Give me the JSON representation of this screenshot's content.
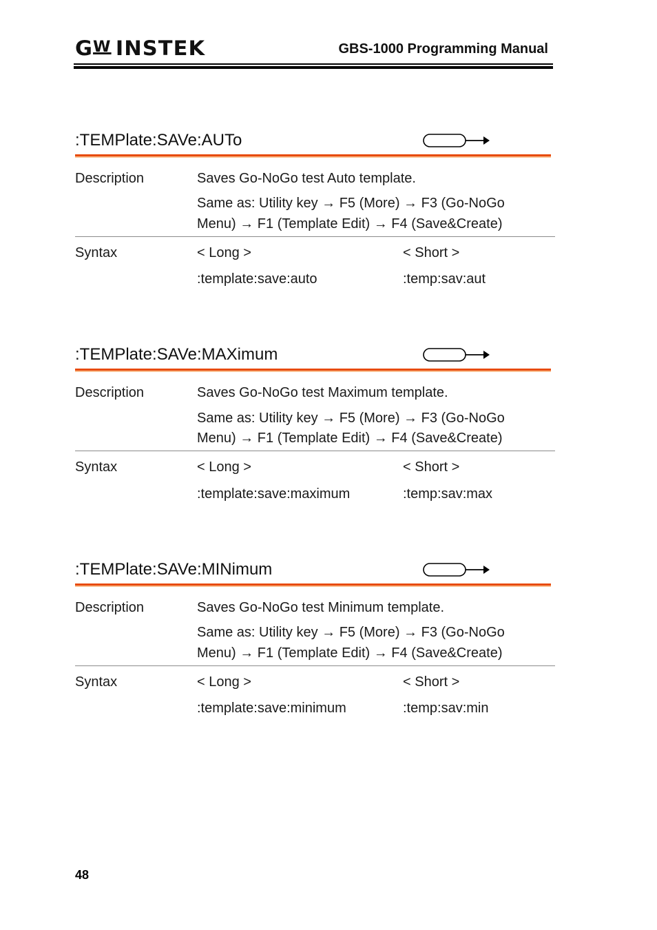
{
  "header": {
    "logo_text": "GW INSTEK",
    "manual_title": "GBS-1000 Programming Manual"
  },
  "labels": {
    "description": "Description",
    "syntax": "Syntax",
    "long_heading": "< Long >",
    "short_heading": "< Short >"
  },
  "accent_color": "#e84b0c",
  "sections": [
    {
      "command": ":TEMPlate:SAVe:AUTo",
      "icon": "set-command-icon",
      "description": "Saves Go-NoGo test Auto template.",
      "same_as_line1": "Same as: Utility key → F5 (More) → F3 (Go-NoGo",
      "same_as_line2": "Menu) → F1 (Template Edit) → F4 (Save&Create)",
      "long": ":template:save:auto",
      "short": ":temp:sav:aut"
    },
    {
      "command": ":TEMPlate:SAVe:MAXimum",
      "icon": "set-command-icon",
      "description": "Saves Go-NoGo test Maximum template.",
      "same_as_line1": "Same as: Utility key → F5 (More) → F3 (Go-NoGo",
      "same_as_line2": "Menu) → F1 (Template Edit) → F4 (Save&Create)",
      "long": ":template:save:maximum",
      "short": ":temp:sav:max"
    },
    {
      "command": ":TEMPlate:SAVe:MINimum",
      "icon": "set-command-icon",
      "description": "Saves Go-NoGo test Minimum template.",
      "same_as_line1": "Same as: Utility key → F5 (More) → F3 (Go-NoGo",
      "same_as_line2": "Menu) → F1 (Template Edit) → F4 (Save&Create)",
      "long": ":template:save:minimum",
      "short": ":temp:sav:min"
    }
  ],
  "footer": {
    "page_number": "48"
  }
}
